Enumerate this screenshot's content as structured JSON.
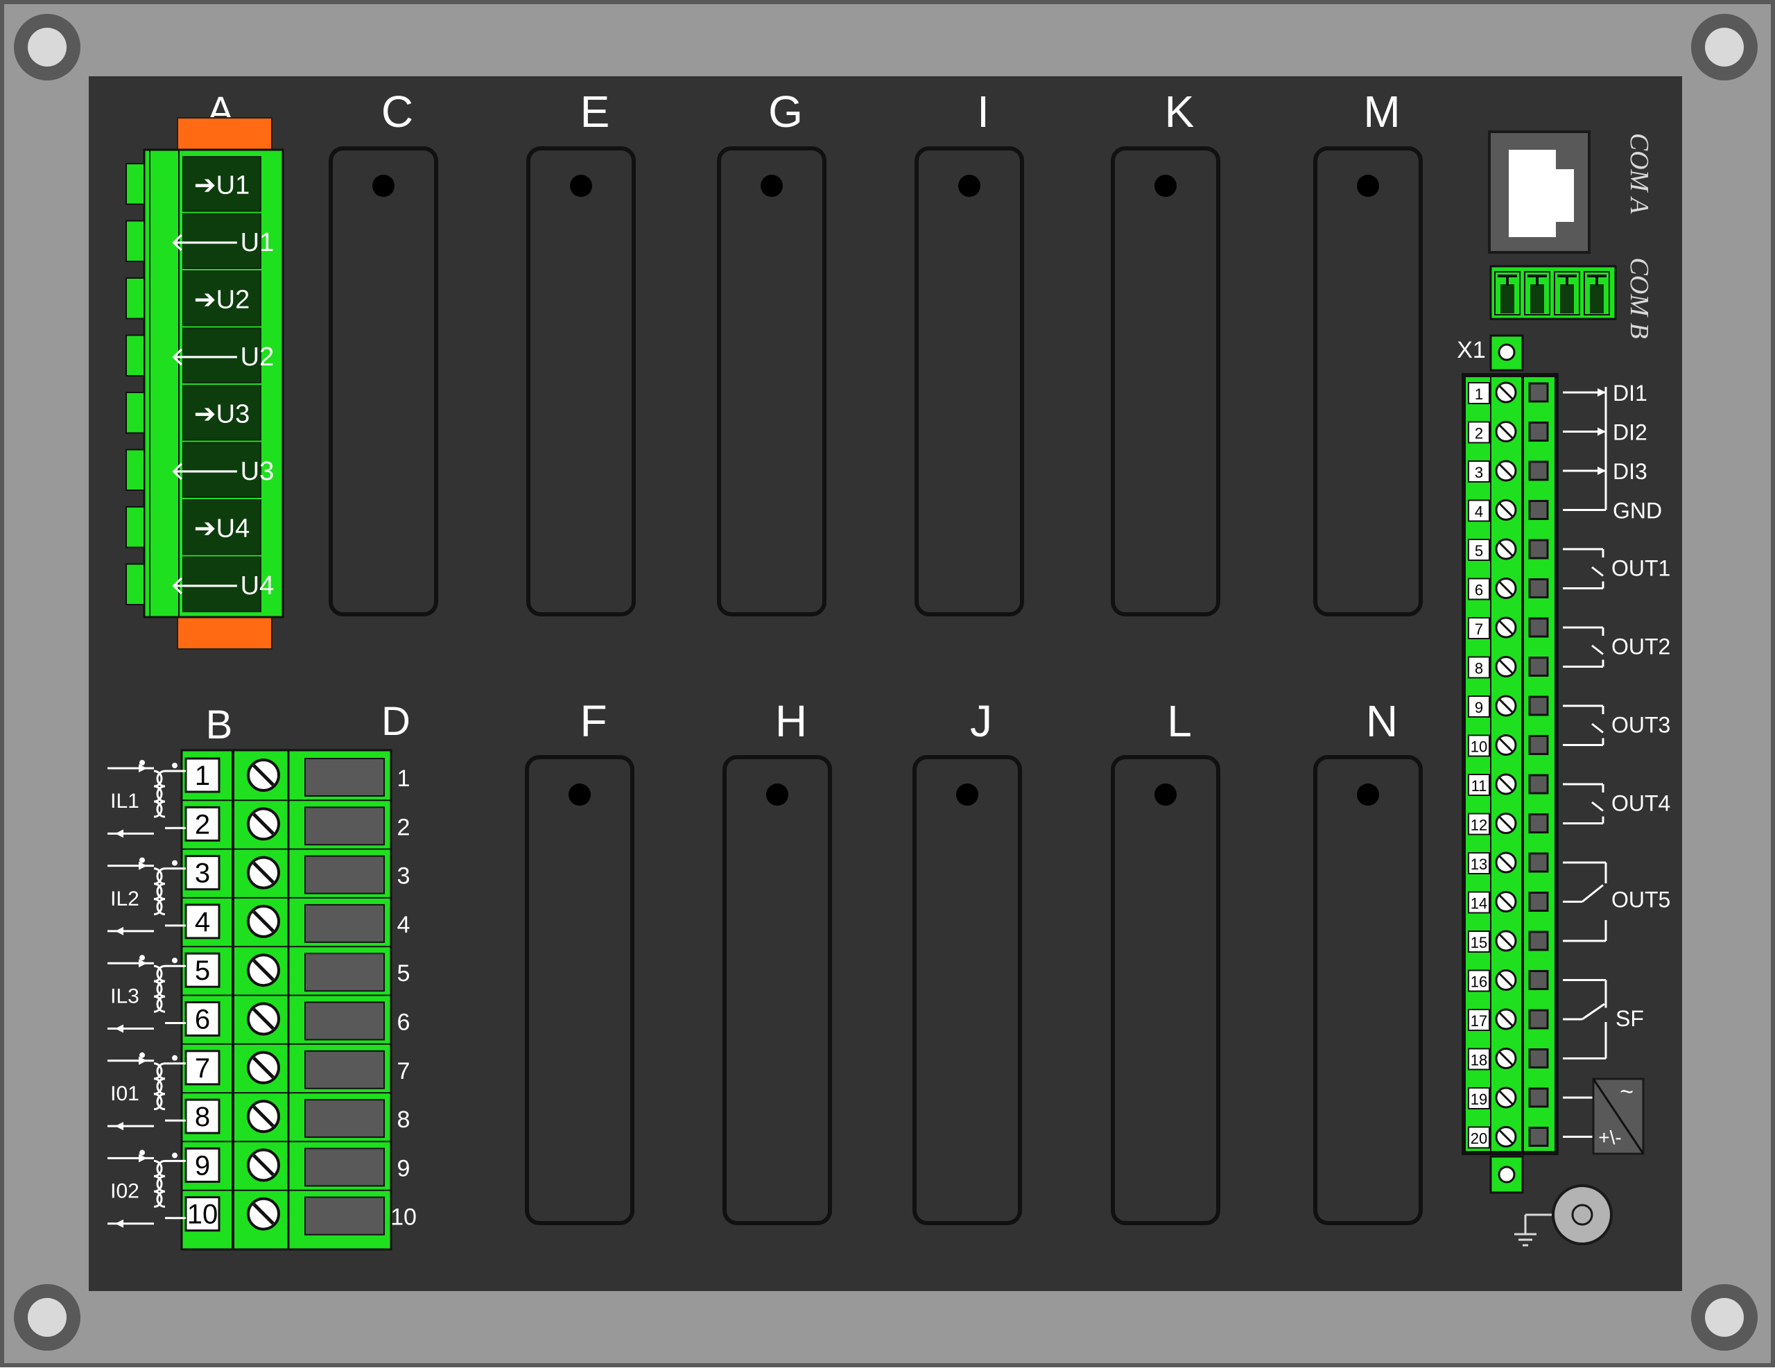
{
  "slots_top": [
    "C",
    "E",
    "G",
    "I",
    "K",
    "M"
  ],
  "slots_bottom": [
    "F",
    "H",
    "J",
    "L",
    "N"
  ],
  "module_a": {
    "label": "A",
    "terminals": [
      "➔U1",
      "🡐U1",
      "➔U2",
      "🡐U2",
      "➔U3",
      "🡐U3",
      "➔U4",
      "🡐U4"
    ]
  },
  "module_b": {
    "label_b": "B",
    "label_d": "D",
    "terminal_numbers": [
      "1",
      "2",
      "3",
      "4",
      "5",
      "6",
      "7",
      "8",
      "9",
      "10"
    ],
    "transformers": [
      "IL1",
      "IL2",
      "IL3",
      "I01",
      "I02"
    ]
  },
  "com": {
    "label_a": "COM A",
    "label_b": "COM B"
  },
  "x1": {
    "label": "X1",
    "pins": [
      "1",
      "2",
      "3",
      "4",
      "5",
      "6",
      "7",
      "8",
      "9",
      "10",
      "11",
      "12",
      "13",
      "14",
      "15",
      "16",
      "17",
      "18",
      "19",
      "20"
    ],
    "inputs": [
      "DI1",
      "DI2",
      "DI3",
      "GND"
    ],
    "outputs": [
      "OUT1",
      "OUT2",
      "OUT3",
      "OUT4",
      "OUT5",
      "SF"
    ],
    "psu_ac": "~",
    "psu_dc": "+\\-"
  },
  "colors": {
    "frame": "#999999",
    "panel": "#333333",
    "terminal_green": "#1fe01f",
    "connector_orange": "#ff6a13",
    "slot_fill": "#333333"
  }
}
